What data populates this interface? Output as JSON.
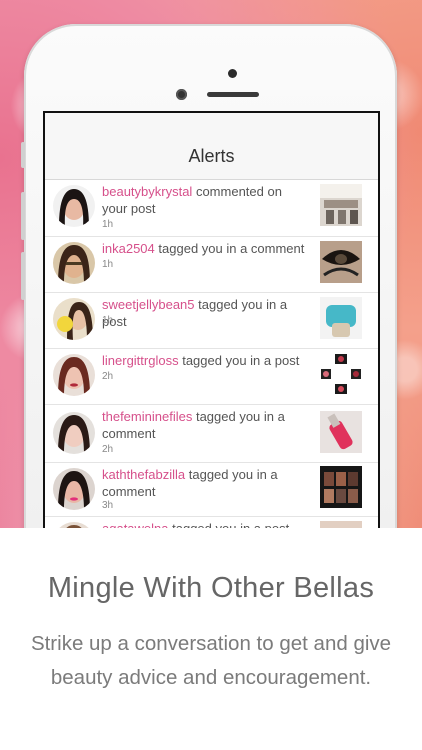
{
  "screen": {
    "title": "Alerts",
    "alerts": [
      {
        "user": "beautybykrystal",
        "action": "commented on your post",
        "time": "1h"
      },
      {
        "user": "inka2504",
        "action": "tagged you in a comment",
        "time": "1h"
      },
      {
        "user": "sweetjellybean5",
        "action": "tagged you in a post",
        "time": "1h"
      },
      {
        "user": "linergittrgloss",
        "action": "tagged you in a post",
        "time": "2h"
      },
      {
        "user": "thefemininefiles",
        "action": "tagged you in a comment",
        "time": "2h"
      },
      {
        "user": "kaththefabzilla",
        "action": "tagged you in a comment",
        "time": "3h"
      },
      {
        "user": "agatawelna",
        "action": "tagged you in a post",
        "time": ""
      }
    ]
  },
  "caption": {
    "headline": "Mingle With Other Bellas",
    "body": "Strike up a conversation to get and give beauty advice and encouragement."
  },
  "colors": {
    "username": "#d6508b",
    "powder_pink": "#ec86a0",
    "powder_coral": "#ef8d78"
  }
}
